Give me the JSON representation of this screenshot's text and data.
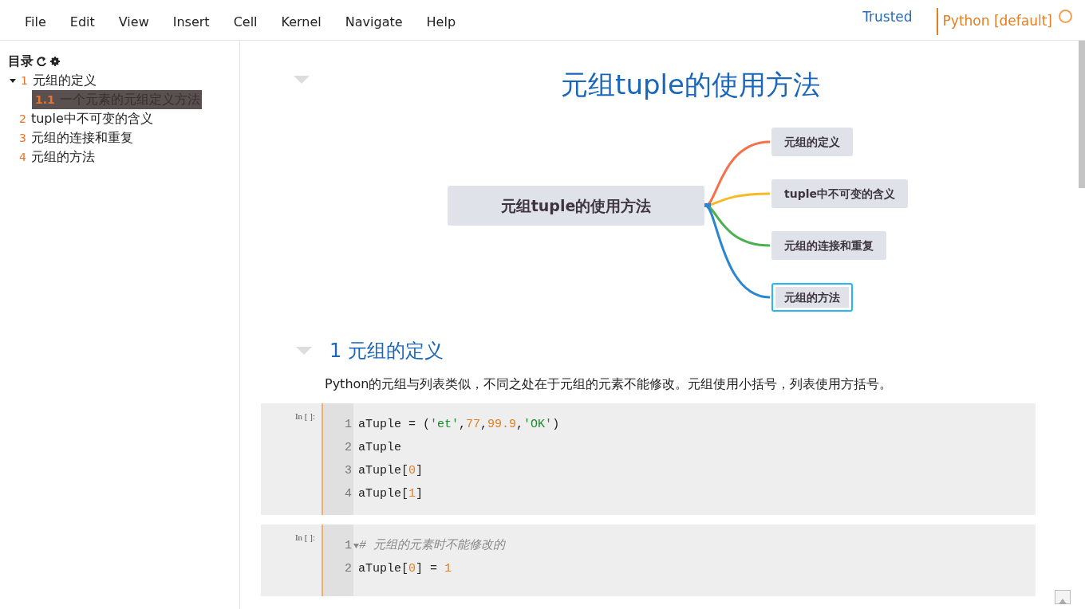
{
  "menu": [
    "File",
    "Edit",
    "View",
    "Insert",
    "Cell",
    "Kernel",
    "Navigate",
    "Help"
  ],
  "trust": "Trusted",
  "kernel": "Python [default]",
  "kernel_busy": false,
  "toc": {
    "title": "目录",
    "items": [
      {
        "number": "1",
        "label": "元组的定义",
        "selected": false,
        "expanded": true,
        "children": [
          {
            "number": "1.1",
            "label": "一个元素的元组定义方法",
            "selected": true
          }
        ]
      },
      {
        "number": "2",
        "label": "tuple中不可变的含义",
        "selected": false
      },
      {
        "number": "3",
        "label": "元组的连接和重复",
        "selected": false
      },
      {
        "number": "4",
        "label": "元组的方法",
        "selected": false
      }
    ]
  },
  "title": "元组tuple的使用方法",
  "mindmap": {
    "root": "元组tuple的使用方法",
    "branches": [
      {
        "label": "元组的定义",
        "color": "#f4714a",
        "selected": false
      },
      {
        "label": "tuple中不可变的含义",
        "color": "#f7b924",
        "selected": false
      },
      {
        "label": "元组的连接和重复",
        "color": "#4caf50",
        "selected": false
      },
      {
        "label": "元组的方法",
        "color": "#2a86d1",
        "selected": true
      }
    ]
  },
  "section": {
    "number": "1",
    "title": "元组的定义"
  },
  "paragraph": "Python的元组与列表类似，不同之处在于元组的元素不能修改。元组使用小括号，列表使用方括号。",
  "cells": [
    {
      "prompt": "In [ ]:",
      "lines": [
        {
          "number": "1",
          "foldable": false,
          "tokens": [
            {
              "kind": "plain",
              "text": "aTuple = ("
            },
            {
              "kind": "string",
              "text": "'et'"
            },
            {
              "kind": "plain",
              "text": ","
            },
            {
              "kind": "number",
              "text": "77"
            },
            {
              "kind": "plain",
              "text": ","
            },
            {
              "kind": "number",
              "text": "99.9"
            },
            {
              "kind": "plain",
              "text": ","
            },
            {
              "kind": "string",
              "text": "'OK'"
            },
            {
              "kind": "plain",
              "text": ")"
            }
          ]
        },
        {
          "number": "2",
          "foldable": false,
          "tokens": [
            {
              "kind": "plain",
              "text": "aTuple"
            }
          ]
        },
        {
          "number": "3",
          "foldable": false,
          "tokens": [
            {
              "kind": "plain",
              "text": "aTuple["
            },
            {
              "kind": "number",
              "text": "0"
            },
            {
              "kind": "plain",
              "text": "]"
            }
          ]
        },
        {
          "number": "4",
          "foldable": false,
          "tokens": [
            {
              "kind": "plain",
              "text": "aTuple["
            },
            {
              "kind": "number",
              "text": "1"
            },
            {
              "kind": "plain",
              "text": "]"
            }
          ]
        }
      ]
    },
    {
      "prompt": "In [ ]:",
      "lines": [
        {
          "number": "1",
          "foldable": true,
          "tokens": [
            {
              "kind": "comment",
              "text": "# 元组的元素时不能修改的"
            }
          ]
        },
        {
          "number": "2",
          "foldable": false,
          "tokens": [
            {
              "kind": "plain",
              "text": "aTuple["
            },
            {
              "kind": "number",
              "text": "0"
            },
            {
              "kind": "plain",
              "text": "] = "
            },
            {
              "kind": "number",
              "text": "1"
            }
          ]
        }
      ]
    }
  ]
}
